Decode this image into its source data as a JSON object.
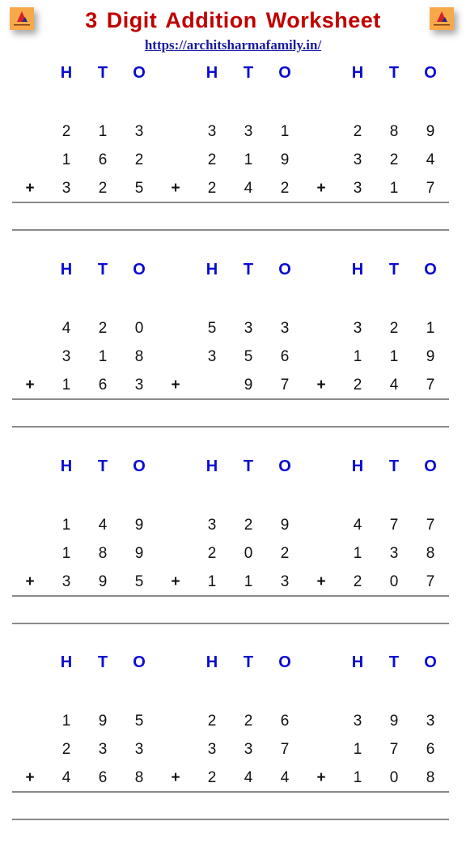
{
  "header": {
    "title": "3 Digit Addition Worksheet",
    "url": "https://architsharmafamily.in/",
    "logo_icon": "architsharma-family-logo",
    "title_color": "#c00000",
    "url_color": "#1a1aa0",
    "heading_color": "#0b0bd0"
  },
  "place_value_headings": [
    "H",
    "T",
    "O"
  ],
  "operator": "+",
  "sections": [
    {
      "problems": [
        {
          "addends": [
            [
              "2",
              "1",
              "3"
            ],
            [
              "1",
              "6",
              "2"
            ],
            [
              "3",
              "2",
              "5"
            ]
          ]
        },
        {
          "addends": [
            [
              "3",
              "3",
              "1"
            ],
            [
              "2",
              "1",
              "9"
            ],
            [
              "2",
              "4",
              "2"
            ]
          ]
        },
        {
          "addends": [
            [
              "2",
              "8",
              "9"
            ],
            [
              "3",
              "2",
              "4"
            ],
            [
              "3",
              "1",
              "7"
            ]
          ]
        }
      ]
    },
    {
      "problems": [
        {
          "addends": [
            [
              "4",
              "2",
              "0"
            ],
            [
              "3",
              "1",
              "8"
            ],
            [
              "1",
              "6",
              "3"
            ]
          ]
        },
        {
          "addends": [
            [
              "5",
              "3",
              "3"
            ],
            [
              "3",
              "5",
              "6"
            ],
            [
              "",
              "9",
              "7"
            ]
          ]
        },
        {
          "addends": [
            [
              "3",
              "2",
              "1"
            ],
            [
              "1",
              "1",
              "9"
            ],
            [
              "2",
              "4",
              "7"
            ]
          ]
        }
      ]
    },
    {
      "problems": [
        {
          "addends": [
            [
              "1",
              "4",
              "9"
            ],
            [
              "1",
              "8",
              "9"
            ],
            [
              "3",
              "9",
              "5"
            ]
          ]
        },
        {
          "addends": [
            [
              "3",
              "2",
              "9"
            ],
            [
              "2",
              "0",
              "2"
            ],
            [
              "1",
              "1",
              "3"
            ]
          ]
        },
        {
          "addends": [
            [
              "4",
              "7",
              "7"
            ],
            [
              "1",
              "3",
              "8"
            ],
            [
              "2",
              "0",
              "7"
            ]
          ]
        }
      ]
    },
    {
      "problems": [
        {
          "addends": [
            [
              "1",
              "9",
              "5"
            ],
            [
              "2",
              "3",
              "3"
            ],
            [
              "4",
              "6",
              "8"
            ]
          ]
        },
        {
          "addends": [
            [
              "2",
              "2",
              "6"
            ],
            [
              "3",
              "3",
              "7"
            ],
            [
              "2",
              "4",
              "4"
            ]
          ]
        },
        {
          "addends": [
            [
              "3",
              "9",
              "3"
            ],
            [
              "1",
              "7",
              "6"
            ],
            [
              "1",
              "0",
              "8"
            ]
          ]
        }
      ]
    }
  ]
}
